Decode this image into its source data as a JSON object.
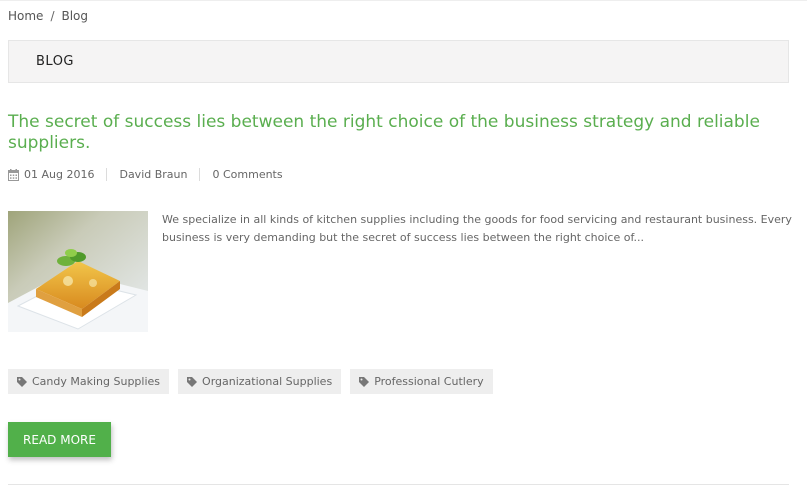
{
  "breadcrumb": {
    "home": "Home",
    "separator": "/",
    "current": "Blog"
  },
  "section": {
    "title": "BLOG"
  },
  "post": {
    "title": "The secret of success lies between the right choice of the business strategy and reliable suppliers.",
    "date": "01 Aug 2016",
    "author": "David Braun",
    "comments": "0 Comments",
    "excerpt": "We specialize in all kinds of kitchen supplies including the goods for food servicing and restaurant business. Every business is very demanding but the secret of success lies between the right choice of...",
    "tags": [
      "Candy Making Supplies",
      "Organizational Supplies",
      "Professional Cutlery"
    ],
    "read_more": "READ MORE"
  },
  "icons": {
    "date": "calendar-icon",
    "tag": "tag-icon"
  },
  "colors": {
    "accent": "#51b04a",
    "title": "#5aae4f",
    "panel": "#f5f4f4",
    "tag_bg": "#eeeeee"
  }
}
